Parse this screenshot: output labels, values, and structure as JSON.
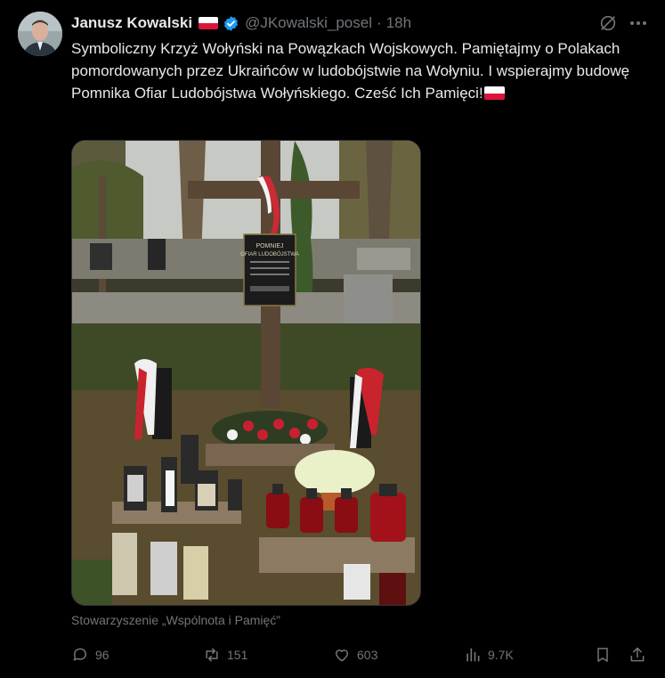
{
  "post": {
    "author_name": "Janusz Kowalski",
    "handle": "@JKowalski_posel",
    "separator": "·",
    "time": "18h",
    "text_main": "Symboliczny Krzyż Wołyński na Powązkach Wojskowych. Pamiętajmy o Polakach pomordowanych przez Ukraińców w ludobójstwie na Wołyniu. I wspierajmy budowę Pomnika Ofiar Ludobójstwa Wołyńskiego. Cześć Ich Pamięci!",
    "flag_colors": {
      "top": "#ffffff",
      "bottom": "#dc143c"
    },
    "verified_color": "#1d9bf0",
    "media_caption": "Stowarzyszenie „Wspólnota i Pamięć”",
    "plaque_text": [
      "POMNIEJ",
      "OFIAR LUDOBÓJSTWA"
    ]
  },
  "actions": {
    "reply_count": "96",
    "repost_count": "151",
    "like_count": "603",
    "views_count": "9.7K"
  },
  "icons": [
    "grok-icon",
    "more-icon",
    "reply-icon",
    "repost-icon",
    "like-icon",
    "views-icon",
    "bookmark-icon",
    "share-icon",
    "verified-icon"
  ]
}
